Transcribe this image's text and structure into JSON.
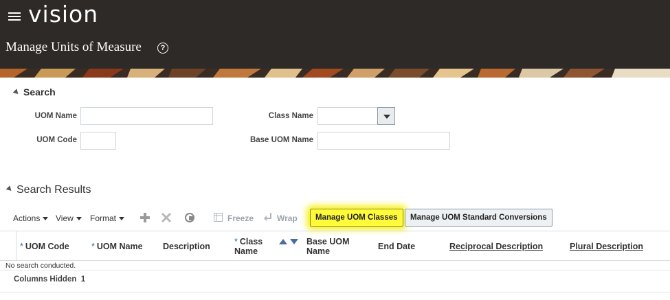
{
  "header": {
    "logo": "vision",
    "page_title": "Manage Units of Measure",
    "help_glyph": "?"
  },
  "search": {
    "title": "Search",
    "uom_name_label": "UOM Name",
    "uom_name_value": "",
    "uom_code_label": "UOM Code",
    "uom_code_value": "",
    "class_name_label": "Class Name",
    "class_name_value": "",
    "base_uom_name_label": "Base UOM Name",
    "base_uom_name_value": ""
  },
  "results": {
    "title": "Search Results",
    "toolbar": {
      "actions": "Actions",
      "view": "View",
      "format": "Format",
      "freeze": "Freeze",
      "wrap": "Wrap",
      "manage_classes": "Manage UOM Classes",
      "manage_conversions": "Manage UOM Standard Conversions"
    },
    "columns": {
      "uom_code": "UOM Code",
      "uom_name": "UOM Name",
      "description": "Description",
      "class_name_1": "Class",
      "class_name_2": "Name",
      "base_uom_name_1": "Base UOM",
      "base_uom_name_2": "Name",
      "end_date": "End Date",
      "reciprocal_description": "Reciprocal Description",
      "plural_description": "Plural Description"
    },
    "required_marker": "*",
    "empty_message": "No search conducted.",
    "columns_hidden_label": "Columns Hidden",
    "columns_hidden_count": "1"
  },
  "colors": {
    "header_bg": "#2e2a27",
    "highlight": "#fffb3a",
    "required": "#1f6fb5"
  },
  "icons": [
    "menu-icon",
    "help-icon",
    "disclosure-triangle-icon",
    "add-icon",
    "delete-icon",
    "detach-icon",
    "freeze-icon",
    "wrap-icon",
    "sort-ascending-icon",
    "sort-descending-icon",
    "dropdown-arrow-icon"
  ]
}
